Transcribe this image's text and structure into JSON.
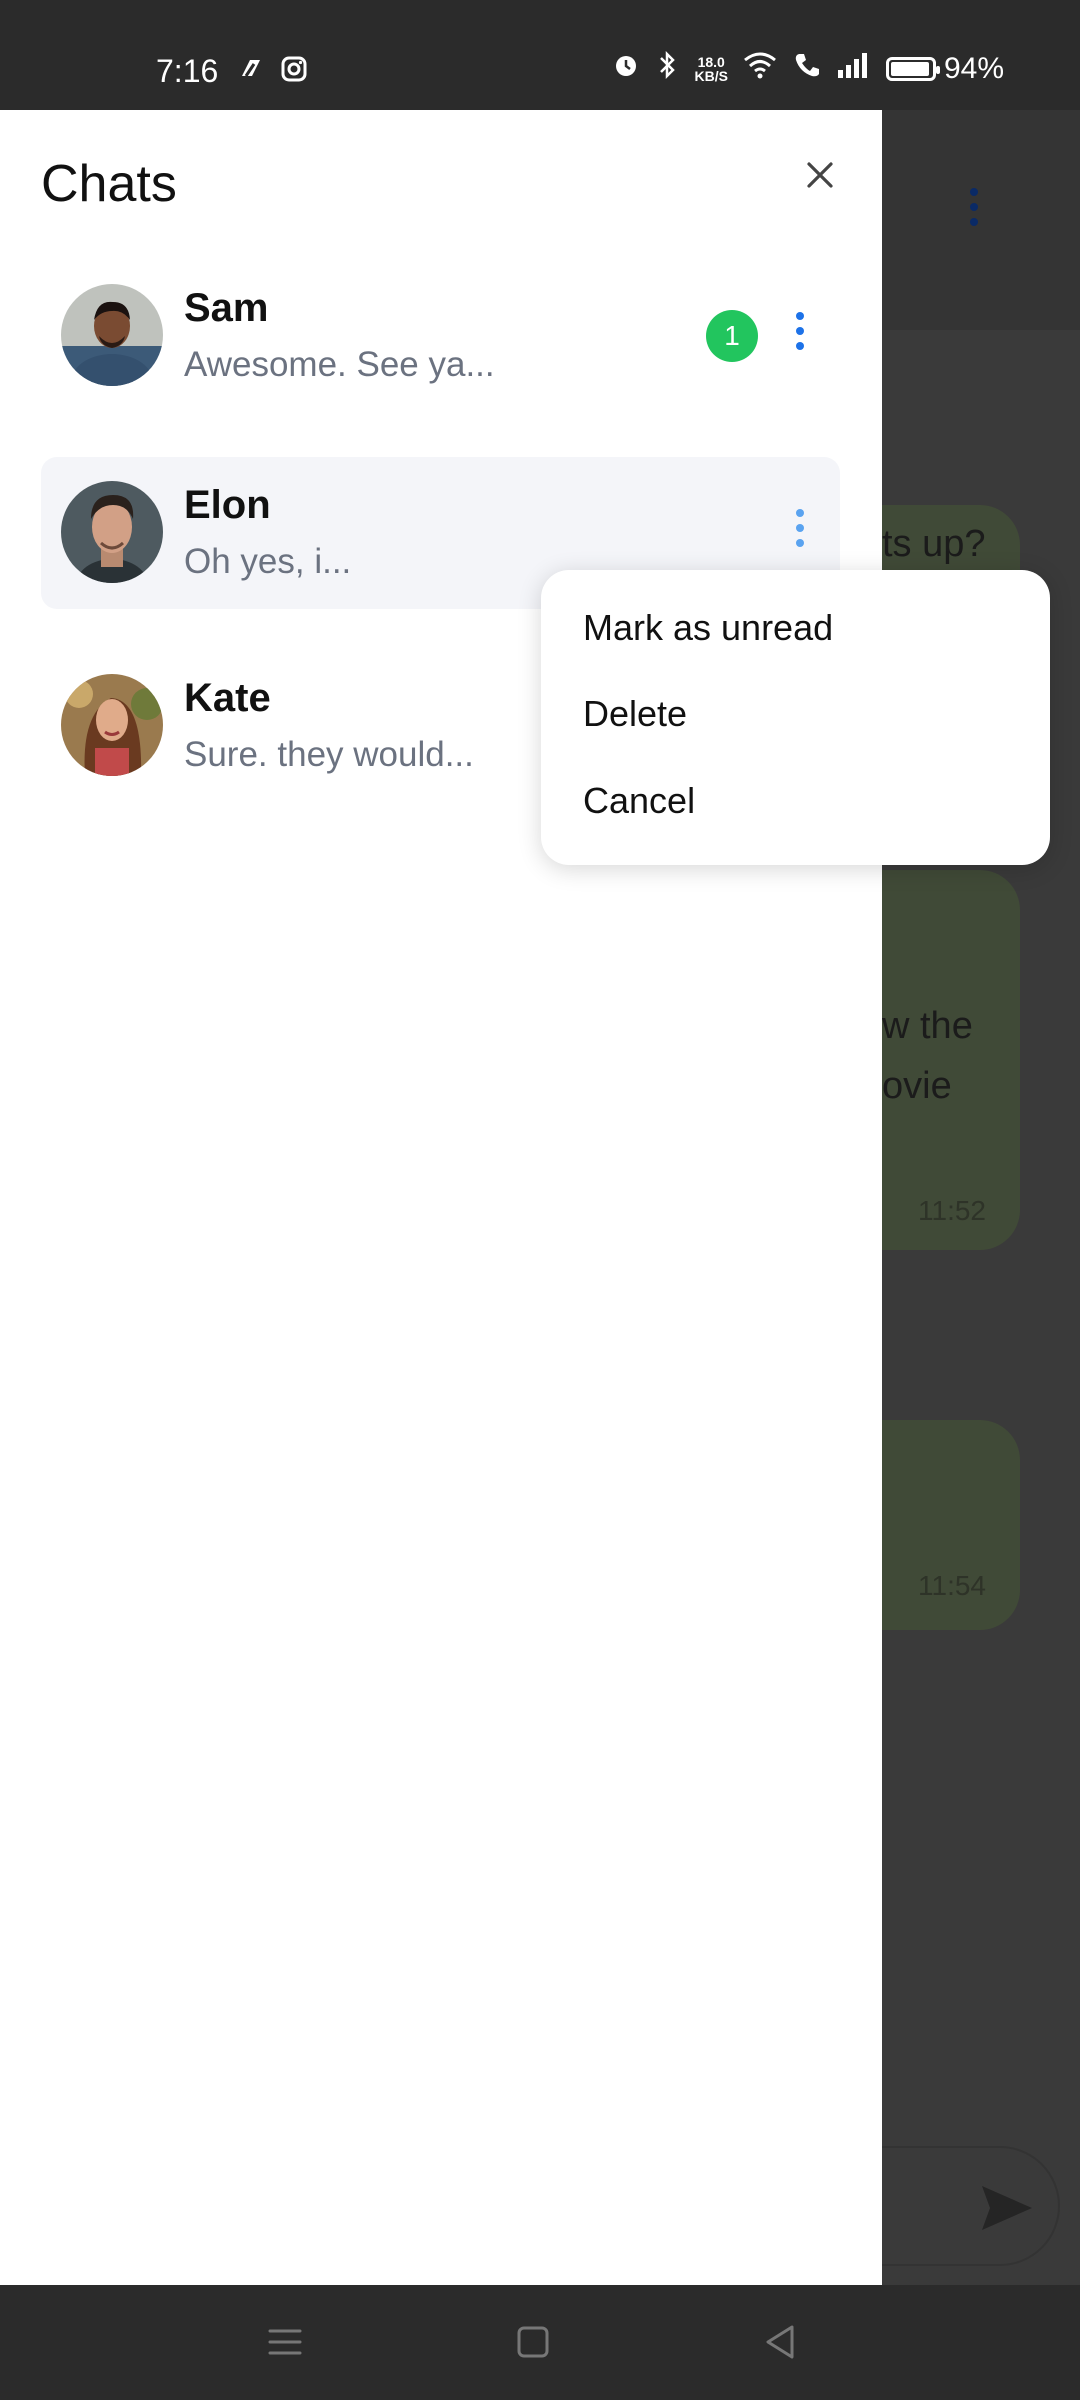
{
  "status_bar": {
    "time": "7:16",
    "left_icons": [
      "app-icon",
      "instagram-icon"
    ],
    "speed_value": "18.0",
    "speed_unit": "KB/S",
    "battery_text": "94%",
    "battery_level": 0.94
  },
  "background_chat": {
    "bubble_1_text": "ts up?",
    "bubble_2_line_1": "w the",
    "bubble_2_line_2": "ovie",
    "bubble_2_time": "11:52",
    "bubble_3_time": "11:54"
  },
  "drawer": {
    "title": "Chats",
    "chats": [
      {
        "name": "Sam",
        "preview": "Awesome. See ya...",
        "unread": "1"
      },
      {
        "name": "Elon",
        "preview": "Oh yes, i..."
      },
      {
        "name": "Kate",
        "preview": "Sure. they would..."
      }
    ]
  },
  "context_menu": {
    "items": [
      "Mark as unread",
      "Delete",
      "Cancel"
    ]
  },
  "colors": {
    "unread_badge": "#22c55e",
    "kebab_accent": "#1d72e8",
    "selected_row": "#f4f5f9"
  }
}
